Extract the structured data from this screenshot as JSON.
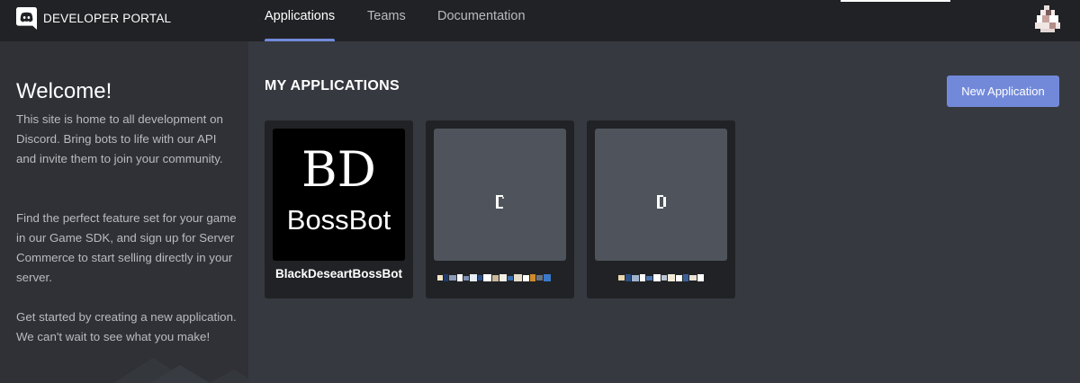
{
  "header": {
    "brand": "DEVELOPER PORTAL",
    "logo_icon": "discord-logo-icon",
    "tabs": [
      {
        "label": "Applications",
        "active": true
      },
      {
        "label": "Teams",
        "active": false
      },
      {
        "label": "Documentation",
        "active": false
      }
    ],
    "avatar_icon": "user-avatar"
  },
  "sidebar": {
    "title": "Welcome!",
    "paragraphs": [
      "This site is home to all development on Discord. Bring bots to life with our API and invite them to join your community.",
      "Find the perfect feature set for your game in our Game SDK, and sign up for Server Commerce to start selling directly in your server.",
      "Get started by creating a new application. We can't wait to see what you make!"
    ]
  },
  "main": {
    "section_title": "MY APPLICATIONS",
    "new_app_label": "New Application",
    "apps": [
      {
        "name": "BlackDeseartBossBot",
        "icon_lines": [
          "BD",
          "BossBot"
        ],
        "icon_type": "image"
      },
      {
        "name": "",
        "name_redacted": true,
        "icon_type": "initial"
      },
      {
        "name": "",
        "name_redacted": true,
        "icon_type": "initial"
      }
    ]
  },
  "colors": {
    "accent": "#7289da",
    "header_bg": "#202225",
    "sidebar_bg": "#2f3136",
    "main_bg": "#36393f",
    "card_bg": "#202225",
    "icon_placeholder": "#4f545c"
  }
}
